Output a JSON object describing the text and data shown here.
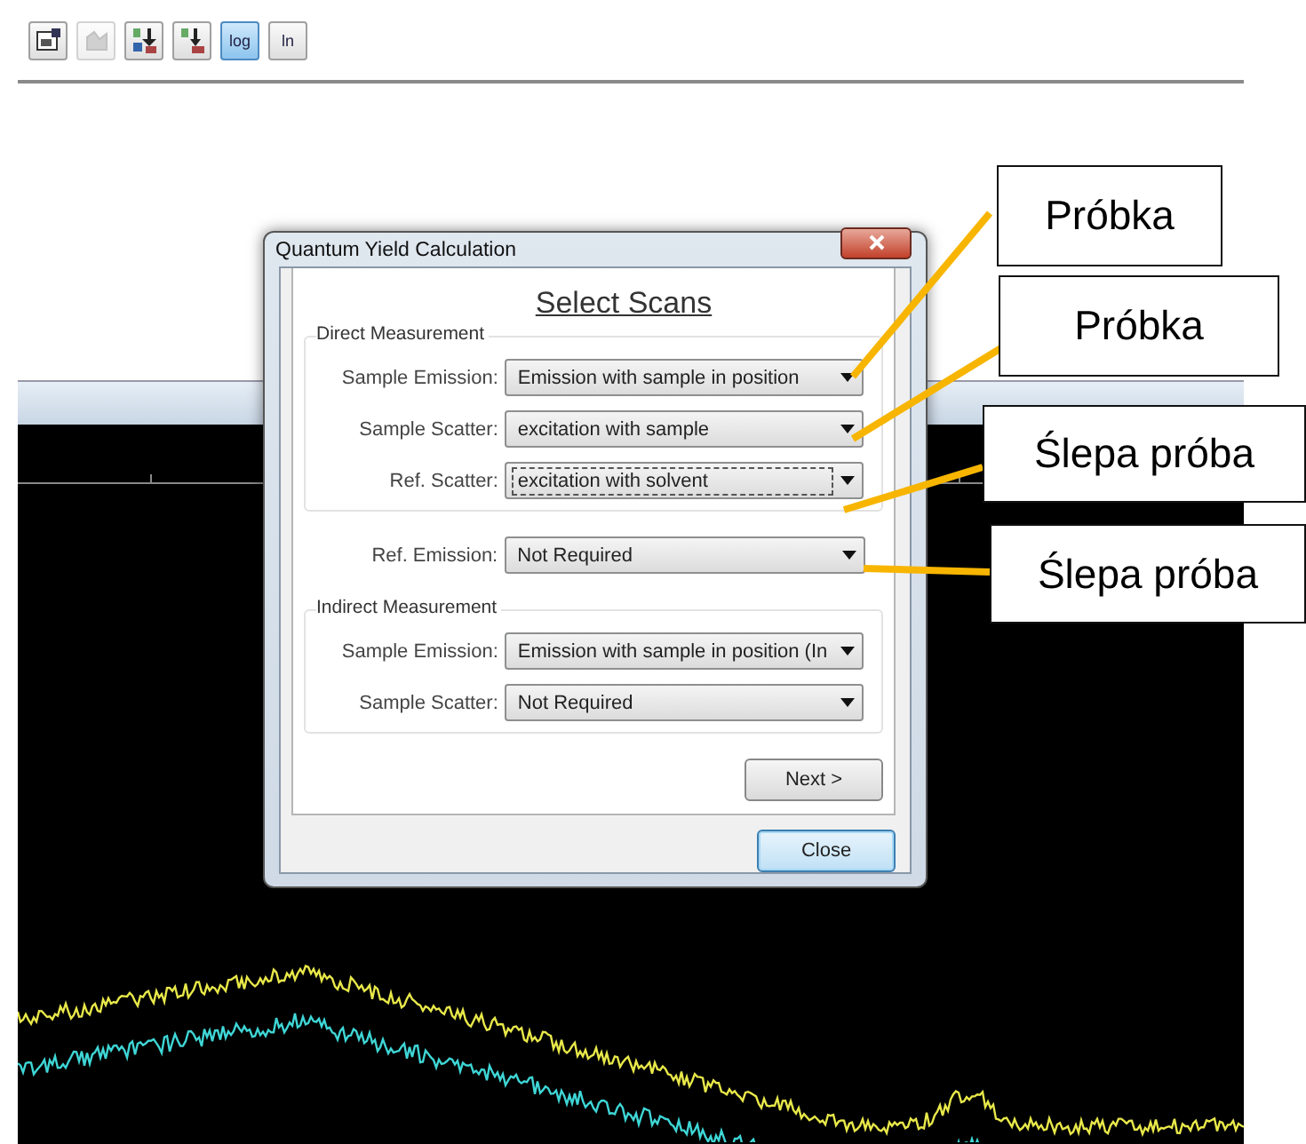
{
  "toolbar": {
    "buttons": [
      {
        "kind": "icon",
        "selected": false,
        "disabled": false
      },
      {
        "kind": "icon",
        "selected": false,
        "disabled": true
      },
      {
        "kind": "icon",
        "selected": false,
        "disabled": false
      },
      {
        "kind": "icon",
        "selected": false,
        "disabled": false
      },
      {
        "kind": "text",
        "label": "log",
        "selected": true,
        "disabled": false
      },
      {
        "kind": "text",
        "label": "ln",
        "selected": false,
        "disabled": false
      }
    ]
  },
  "dialog": {
    "title": "Quantum Yield Calculation",
    "heading": "Select Scans",
    "direct": {
      "legend": "Direct Measurement",
      "rows": [
        {
          "label": "Sample Emission:",
          "value": "Emission with sample in position",
          "focused": false
        },
        {
          "label": "Sample Scatter:",
          "value": "excitation with sample",
          "focused": false
        },
        {
          "label": "Ref. Scatter:",
          "value": "excitation with solvent",
          "focused": true
        }
      ]
    },
    "ref_emission": {
      "label": "Ref. Emission:",
      "value": "Not Required",
      "focused": false
    },
    "indirect": {
      "legend": "Indirect Measurement",
      "rows": [
        {
          "label": "Sample Emission:",
          "value": "Emission with sample in position (In",
          "focused": false
        },
        {
          "label": "Sample Scatter:",
          "value": "Not Required",
          "focused": false
        }
      ]
    },
    "buttons": [
      {
        "label": "Next >",
        "default": false
      },
      {
        "label": "Close",
        "default": true
      }
    ]
  },
  "callouts": [
    {
      "text": "Próbka"
    },
    {
      "text": "Próbka"
    },
    {
      "text": "Ślepa próba"
    },
    {
      "text": "Ślepa próba"
    }
  ]
}
